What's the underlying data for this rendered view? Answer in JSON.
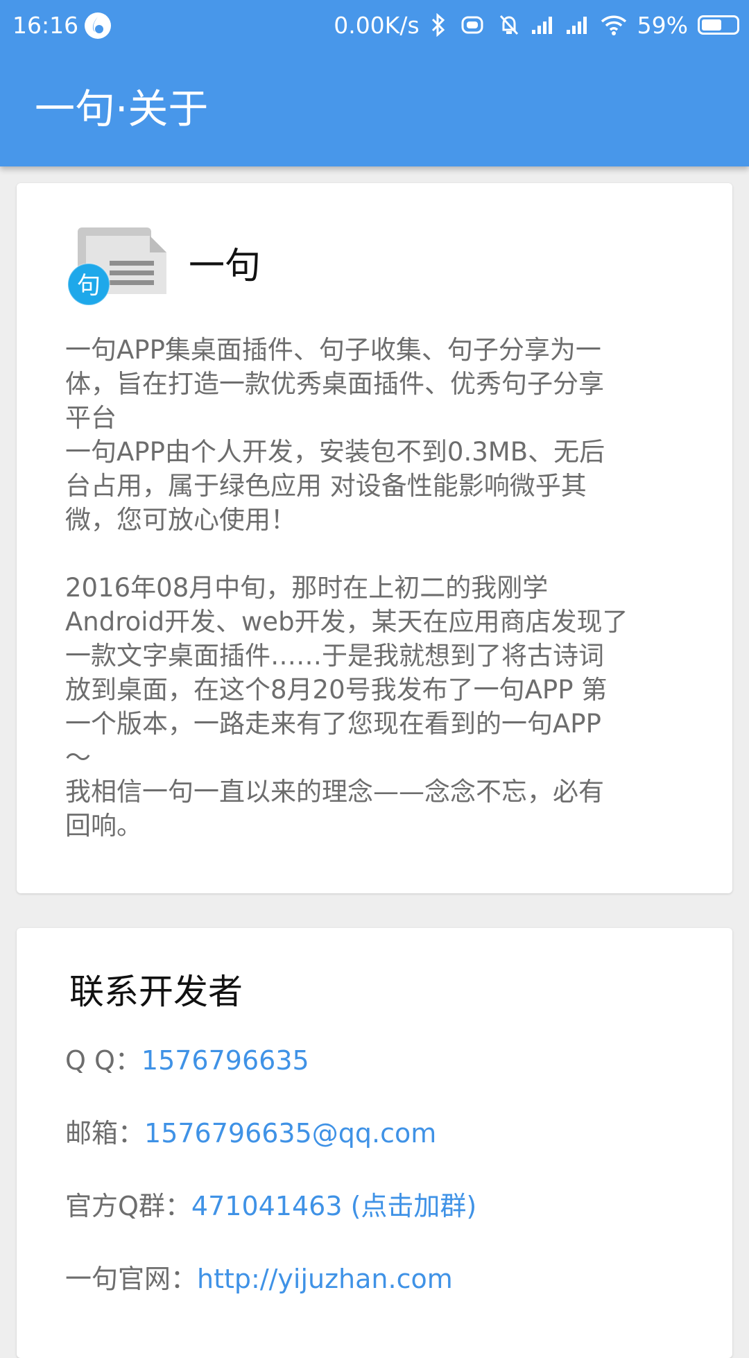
{
  "status_bar": {
    "time": "16:16",
    "network_speed": "0.00K/s",
    "battery": "59%",
    "battery_level": 0.59,
    "icons": [
      "app-notification-icon",
      "bluetooth-icon",
      "vibrate-icon",
      "alarm-off-icon",
      "signal-icon",
      "signal-icon",
      "wifi-icon",
      "battery-icon"
    ]
  },
  "appbar": {
    "title": "一句·关于"
  },
  "about": {
    "app_name": "一句",
    "logo_badge": "句",
    "description": "一句APP集桌面插件、句子收集、句子分享为一\n体，旨在打造一款优秀桌面插件、优秀句子分享\n平台\n一句APP由个人开发，安装包不到0.3MB、无后\n台占用，属于绿色应用 对设备性能影响微乎其\n微，您可放心使用！\n\n2016年08月中旬，那时在上初二的我刚学\nAndroid开发、web开发，某天在应用商店发现了\n一款文字桌面插件……于是我就想到了将古诗词\n放到桌面，在这个8月20号我发布了一句APP 第\n一个版本，一路走来有了您现在看到的一句APP\n～\n我相信一句一直以来的理念——念念不忘，必有\n回响。"
  },
  "contact": {
    "title": "联系开发者",
    "qq_label": "Q Q：",
    "qq_value": "1576796635",
    "email_label": "邮箱：",
    "email_value": "1576796635@qq.com",
    "group_label": "官方Q群：",
    "group_value": "471041463 (点击加群)",
    "site_label": "一句官网：",
    "site_value": "http://yijuzhan.com"
  },
  "colors": {
    "primary": "#4897ea",
    "link": "#3f92e6",
    "body_text": "#6d6d6d",
    "background": "#eeeeee"
  }
}
